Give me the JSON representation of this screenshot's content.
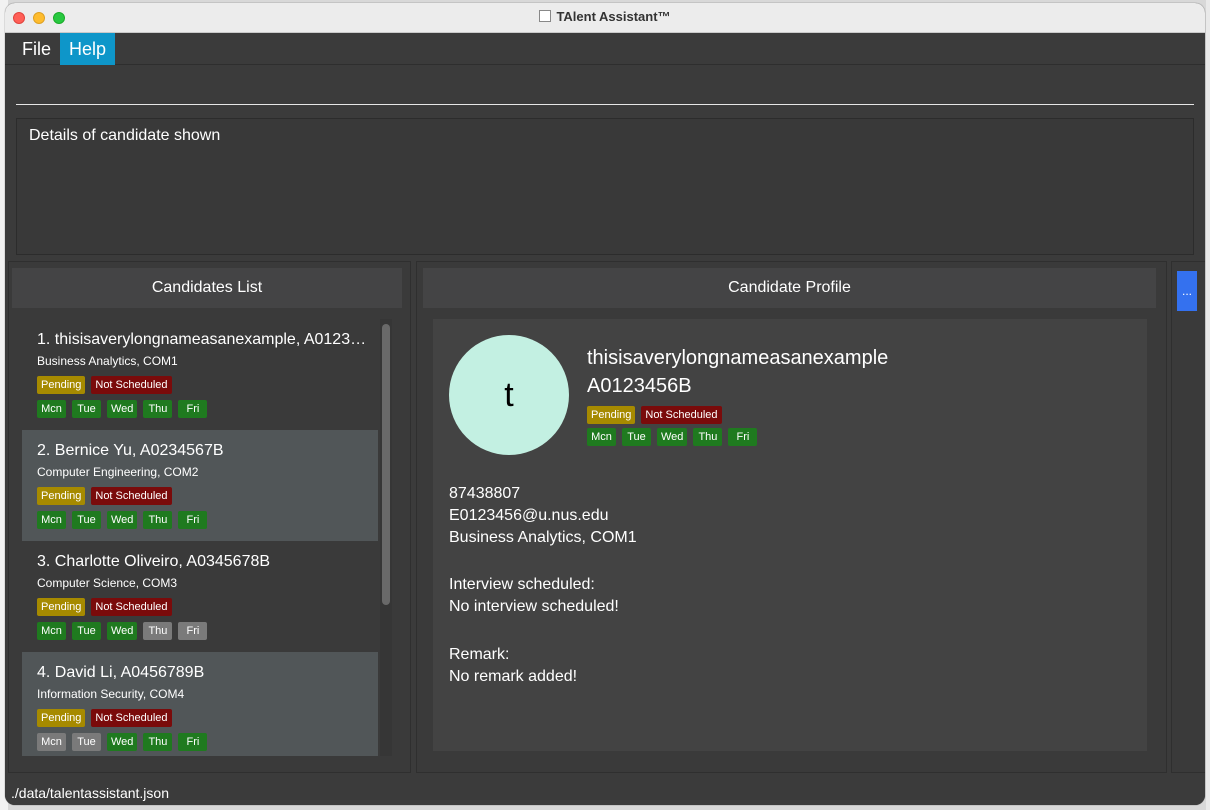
{
  "window": {
    "title": "TAlent Assistant™"
  },
  "menu": {
    "file": "File",
    "help": "Help"
  },
  "command": {
    "value": ""
  },
  "result": {
    "text": "Details of candidate shown"
  },
  "panels": {
    "list_title": "Candidates List",
    "profile_title": "Candidate Profile"
  },
  "colors": {
    "pending": "#a68a00",
    "not_scheduled": "#7a0b0b",
    "day_available": "#1f7a1f",
    "day_unavailable": "#7a7a7a",
    "menu_active": "#0e96c9",
    "side_button": "#3471ef"
  },
  "candidates": [
    {
      "header": "1.  thisisaverylongnameasanexample, A012345...",
      "course": "Business Analytics, COM1",
      "status": "Pending",
      "interview": "Not Scheduled",
      "days": [
        {
          "label": "Mcn",
          "available": true
        },
        {
          "label": "Tue",
          "available": true
        },
        {
          "label": "Wed",
          "available": true
        },
        {
          "label": "Thu",
          "available": true
        },
        {
          "label": "Fri",
          "available": true
        }
      ]
    },
    {
      "header": "2.  Bernice Yu, A0234567B",
      "course": "Computer Engineering, COM2",
      "status": "Pending",
      "interview": "Not Scheduled",
      "days": [
        {
          "label": "Mcn",
          "available": true
        },
        {
          "label": "Tue",
          "available": true
        },
        {
          "label": "Wed",
          "available": true
        },
        {
          "label": "Thu",
          "available": true
        },
        {
          "label": "Fri",
          "available": true
        }
      ]
    },
    {
      "header": "3.  Charlotte Oliveiro, A0345678B",
      "course": "Computer Science, COM3",
      "status": "Pending",
      "interview": "Not Scheduled",
      "days": [
        {
          "label": "Mcn",
          "available": true
        },
        {
          "label": "Tue",
          "available": true
        },
        {
          "label": "Wed",
          "available": true
        },
        {
          "label": "Thu",
          "available": false
        },
        {
          "label": "Fri",
          "available": false
        }
      ]
    },
    {
      "header": "4.  David Li, A0456789B",
      "course": "Information Security, COM4",
      "status": "Pending",
      "interview": "Not Scheduled",
      "days": [
        {
          "label": "Mcn",
          "available": false
        },
        {
          "label": "Tue",
          "available": false
        },
        {
          "label": "Wed",
          "available": true
        },
        {
          "label": "Thu",
          "available": true
        },
        {
          "label": "Fri",
          "available": true
        }
      ]
    }
  ],
  "profile": {
    "avatar_letter": "t",
    "name": "thisisaverylongnameasanexample",
    "id": "A0123456B",
    "status": "Pending",
    "interview": "Not Scheduled",
    "days": [
      {
        "label": "Mcn",
        "available": true
      },
      {
        "label": "Tue",
        "available": true
      },
      {
        "label": "Wed",
        "available": true
      },
      {
        "label": "Thu",
        "available": true
      },
      {
        "label": "Fri",
        "available": true
      }
    ],
    "phone": "87438807",
    "email": "E0123456@u.nus.edu",
    "course": "Business Analytics, COM1",
    "interview_label": "Interview scheduled:",
    "interview_value": "No interview scheduled!",
    "remark_label": "Remark:",
    "remark_value": "No remark added!"
  },
  "side_button": {
    "label": "..."
  },
  "status_bar": {
    "path": "./data/talentassistant.json"
  }
}
